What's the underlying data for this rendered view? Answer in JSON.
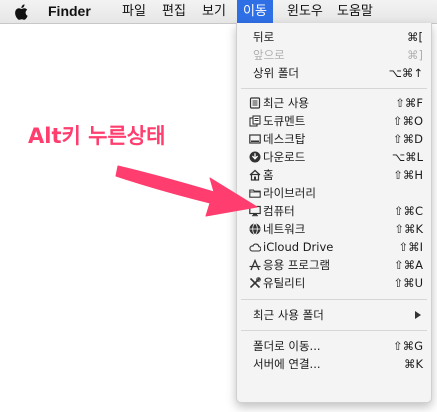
{
  "menubar": {
    "apple_icon": "apple-icon",
    "items": [
      {
        "label": "Finder"
      },
      {
        "label": "파일"
      },
      {
        "label": "편집"
      },
      {
        "label": "보기"
      },
      {
        "label": "이동"
      },
      {
        "label": "윈도우"
      },
      {
        "label": "도움말"
      }
    ],
    "active_index": 4,
    "active_color": "#2f6fe6"
  },
  "menu": {
    "items": [
      {
        "label": "뒤로",
        "shortcut": "⌘[",
        "enabled": true
      },
      {
        "label": "앞으로",
        "shortcut": "⌘]",
        "enabled": false
      },
      {
        "label": "상위 폴더",
        "shortcut": "⌥⌘↑",
        "enabled": true
      },
      {
        "label": "최근 사용",
        "shortcut": "⇧⌘F",
        "icon": "recents-icon"
      },
      {
        "label": "도큐멘트",
        "shortcut": "⇧⌘O",
        "icon": "documents-icon"
      },
      {
        "label": "데스크탑",
        "shortcut": "⇧⌘D",
        "icon": "desktop-icon"
      },
      {
        "label": "다운로드",
        "shortcut": "⌥⌘L",
        "icon": "downloads-icon"
      },
      {
        "label": "홈",
        "shortcut": "⇧⌘H",
        "icon": "home-icon"
      },
      {
        "label": "라이브러리",
        "shortcut": "",
        "icon": "folder-icon"
      },
      {
        "label": "컴퓨터",
        "shortcut": "⇧⌘C",
        "icon": "computer-icon"
      },
      {
        "label": "네트워크",
        "shortcut": "⇧⌘K",
        "icon": "network-icon"
      },
      {
        "label": "iCloud Drive",
        "shortcut": "⇧⌘I",
        "icon": "cloud-icon"
      },
      {
        "label": "응용 프로그램",
        "shortcut": "⇧⌘A",
        "icon": "applications-icon"
      },
      {
        "label": "유틸리티",
        "shortcut": "⇧⌘U",
        "icon": "utilities-icon"
      },
      {
        "label": "최근 사용 폴더",
        "submenu": true
      },
      {
        "label": "폴더로 이동...",
        "shortcut": "⇧⌘G"
      },
      {
        "label": "서버에 연결...",
        "shortcut": "⌘K"
      }
    ]
  },
  "annotation": {
    "text": "Alt키 누른상태",
    "color": "#ff3d6e"
  }
}
